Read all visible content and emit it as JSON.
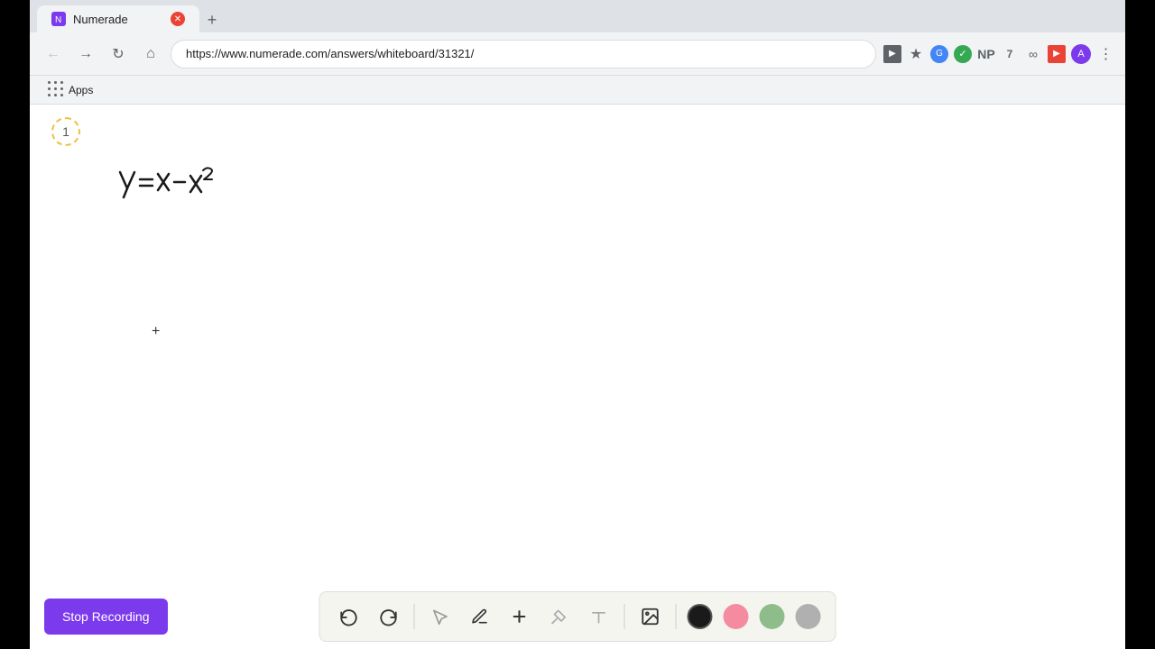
{
  "browser": {
    "tab": {
      "title": "Numerade",
      "url": "https://www.numerade.com/answers/whiteboard/31321/"
    },
    "bookmarks": {
      "apps_label": "Apps"
    }
  },
  "toolbar": {
    "stop_recording_label": "Stop Recording",
    "undo_label": "Undo",
    "redo_label": "Redo",
    "select_label": "Select",
    "pen_label": "Pen",
    "add_label": "Add",
    "highlighter_label": "Highlighter",
    "text_label": "Text",
    "image_label": "Image"
  },
  "page": {
    "number": "1"
  },
  "colors": {
    "black": "#1a1a1a",
    "pink": "#f48ba0",
    "green": "#8fbc8b",
    "gray": "#b0b0b0",
    "purple_button": "#7c3aed"
  }
}
